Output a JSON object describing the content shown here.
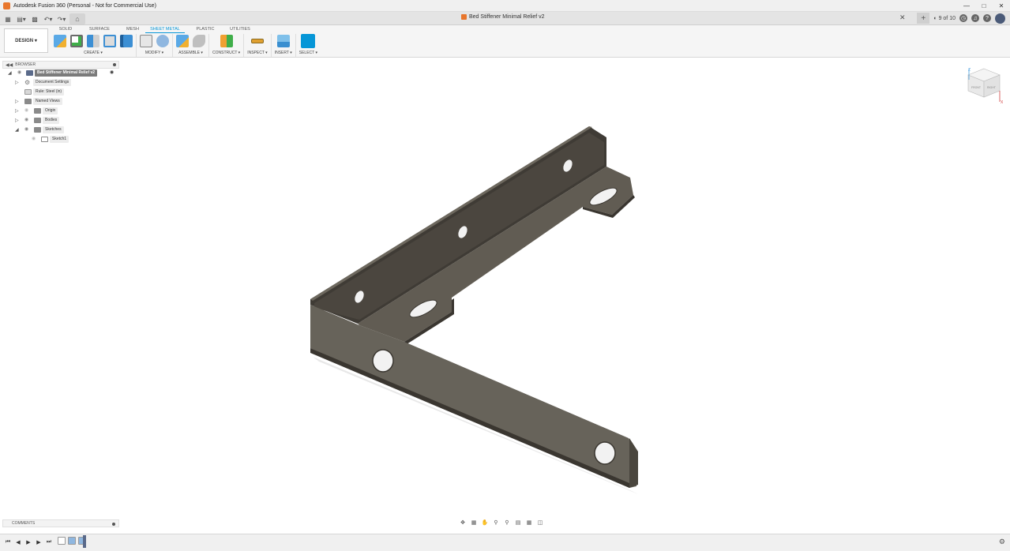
{
  "app": {
    "window_title": "Autodesk Fusion 360 (Personal - Not for Commercial Use)",
    "document_title": "Bed Stiffener Minimal Relief v2",
    "job_status": "9 of 10"
  },
  "toolbar": {
    "workspace": "DESIGN",
    "tabs": [
      {
        "label": "SOLID",
        "active": false
      },
      {
        "label": "SURFACE",
        "active": false
      },
      {
        "label": "MESH",
        "active": false
      },
      {
        "label": "SHEET METAL",
        "active": true
      },
      {
        "label": "PLASTIC",
        "active": false
      },
      {
        "label": "UTILITIES",
        "active": false
      }
    ],
    "groups": [
      {
        "label": "CREATE ▾",
        "icons": [
          "new-component-icon",
          "create-sketch-icon",
          "flange-icon",
          "sheet-metal-rules-icon",
          "extrude-icon"
        ]
      },
      {
        "label": "MODIFY ▾",
        "icons": [
          "unfold-icon",
          "press-pull-icon"
        ]
      },
      {
        "label": "ASSEMBLE ▾",
        "icons": [
          "new-component-icon",
          "joint-icon"
        ]
      },
      {
        "label": "CONSTRUCT ▾",
        "icons": [
          "offset-plane-icon"
        ]
      },
      {
        "label": "INSPECT ▾",
        "icons": [
          "measure-icon"
        ]
      },
      {
        "label": "INSERT ▾",
        "icons": [
          "insert-image-icon"
        ]
      },
      {
        "label": "SELECT ▾",
        "icons": [
          "select-icon"
        ]
      }
    ]
  },
  "browser": {
    "title": "BROWSER",
    "items": [
      {
        "label": "Bed Stiffener Minimal Relief v2",
        "level": 0,
        "icon": "document-icon",
        "selected": true
      },
      {
        "label": "Document Settings",
        "level": 1,
        "icon": "gear-icon",
        "selected": false
      },
      {
        "label": "Rule: Steel (in)",
        "level": 1,
        "icon": "sheet-metal-rule-icon",
        "selected": false
      },
      {
        "label": "Named Views",
        "level": 1,
        "icon": "folder-icon",
        "selected": false
      },
      {
        "label": "Origin",
        "level": 1,
        "icon": "folder-icon",
        "selected": false
      },
      {
        "label": "Bodies",
        "level": 1,
        "icon": "folder-icon",
        "selected": false
      },
      {
        "label": "Sketches",
        "level": 1,
        "icon": "folder-icon",
        "selected": false
      },
      {
        "label": "Sketch1",
        "level": 2,
        "icon": "sketch-icon",
        "selected": false
      }
    ]
  },
  "comments": {
    "title": "COMMENTS"
  },
  "viewcube": {
    "axis_z": "Z",
    "axis_x": "X",
    "face_front": "FRONT",
    "face_right": "RIGHT"
  },
  "colors": {
    "accent": "#0696d7",
    "part": "#5e5a52",
    "selection": "#7b7b7b"
  }
}
